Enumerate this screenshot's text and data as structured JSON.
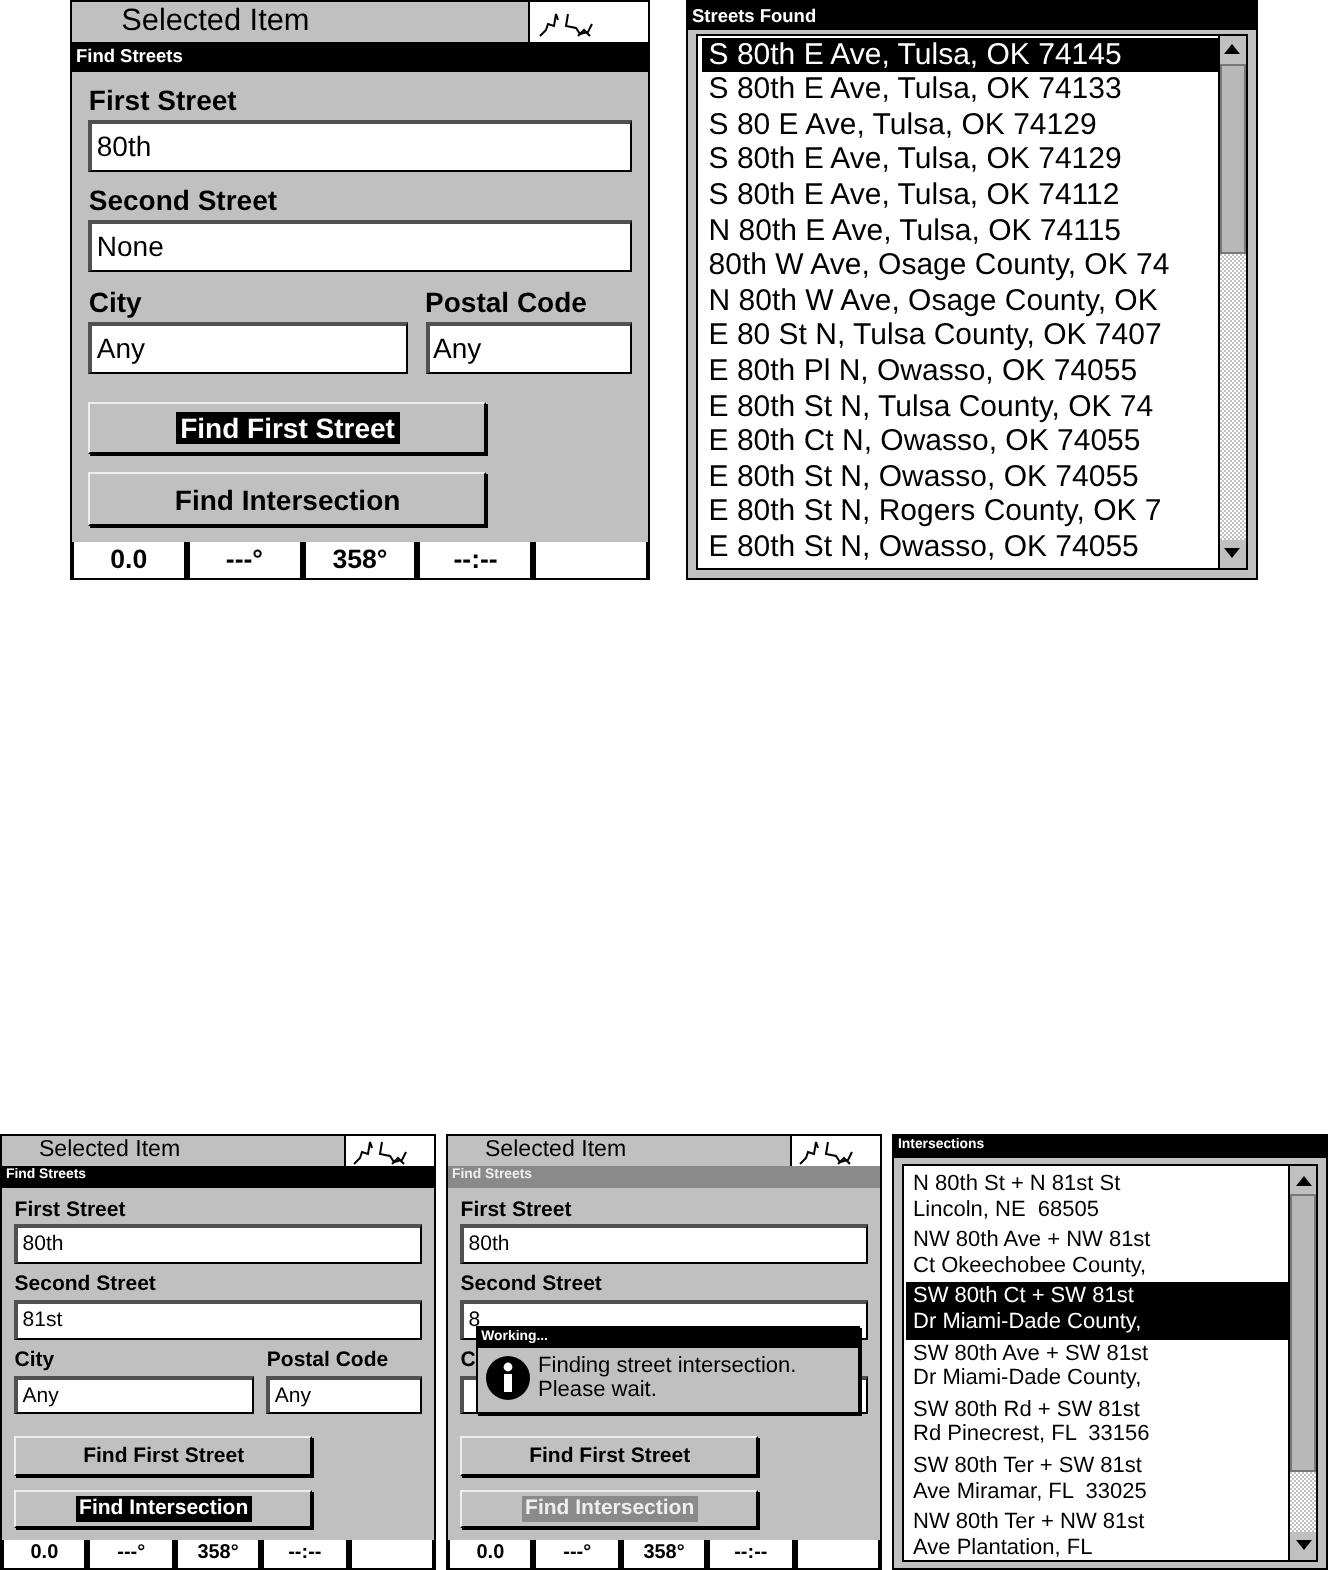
{
  "screens": [
    {
      "kind": "form",
      "header": {
        "title": "Selected Item"
      },
      "title_bar": {
        "text": "Find Streets",
        "active": true
      },
      "fields": [
        {
          "label": "First Street",
          "value": "80th"
        },
        {
          "label": "Second Street",
          "value": "None"
        },
        {
          "label": "City",
          "value": "Any"
        },
        {
          "label": "Postal Code",
          "value": "Any"
        }
      ],
      "buttons": [
        {
          "label": "Find First Street",
          "selected": true
        },
        {
          "label": "Find Intersection",
          "selected": false
        }
      ],
      "status_bar": [
        "0.0",
        "---°",
        "358°",
        "--:--"
      ]
    },
    {
      "kind": "list",
      "title_bar": {
        "text": "Streets Found",
        "active": true
      },
      "items": [
        {
          "lines": [
            "S 80th E Ave, Tulsa, OK 74145"
          ],
          "selected": true
        },
        {
          "lines": [
            "S 80th E Ave, Tulsa, OK 74133"
          ],
          "selected": false
        },
        {
          "lines": [
            "S 80 E Ave, Tulsa, OK 74129"
          ],
          "selected": false
        },
        {
          "lines": [
            "S 80th E Ave, Tulsa, OK 74129"
          ],
          "selected": false
        },
        {
          "lines": [
            "S 80th E Ave, Tulsa, OK 74112"
          ],
          "selected": false
        },
        {
          "lines": [
            "N 80th E Ave, Tulsa, OK 74115"
          ],
          "selected": false
        },
        {
          "lines": [
            "80th W Ave, Osage County, OK 74"
          ],
          "selected": false
        },
        {
          "lines": [
            "N 80th W Ave, Osage County, OK"
          ],
          "selected": false
        },
        {
          "lines": [
            "E 80 St N, Tulsa County, OK 7407"
          ],
          "selected": false
        },
        {
          "lines": [
            "E 80th Pl N, Owasso, OK 74055"
          ],
          "selected": false
        },
        {
          "lines": [
            "E 80th St N, Tulsa County, OK 74"
          ],
          "selected": false
        },
        {
          "lines": [
            "E 80th Ct N, Owasso, OK 74055"
          ],
          "selected": false
        },
        {
          "lines": [
            "E 80th St N, Owasso, OK 74055"
          ],
          "selected": false
        },
        {
          "lines": [
            "E 80th St N, Rogers County, OK 7"
          ],
          "selected": false
        },
        {
          "lines": [
            "E 80th St N, Owasso, OK 74055"
          ],
          "selected": false
        }
      ]
    },
    {
      "kind": "form",
      "header": {
        "title": "Selected Item"
      },
      "title_bar": {
        "text": "Find Streets",
        "active": true
      },
      "fields": [
        {
          "label": "First Street",
          "value": "80th"
        },
        {
          "label": "Second Street",
          "value": "81st"
        },
        {
          "label": "City",
          "value": "Any"
        },
        {
          "label": "Postal Code",
          "value": "Any"
        }
      ],
      "buttons": [
        {
          "label": "Find First Street",
          "selected": false
        },
        {
          "label": "Find Intersection",
          "selected": true
        }
      ],
      "status_bar": [
        "0.0",
        "---°",
        "358°",
        "--:--"
      ]
    },
    {
      "kind": "form",
      "header": {
        "title": "Selected Item"
      },
      "title_bar": {
        "text": "Find Streets",
        "active": false
      },
      "fields": [
        {
          "label": "First Street",
          "value": "80th"
        },
        {
          "label": "Second Street",
          "value": "8"
        },
        {
          "label": "C"
        }
      ],
      "buttons": [
        {
          "label": "Find First Street",
          "selected": false
        },
        {
          "label": "Find Intersection",
          "selected": true
        }
      ],
      "dialog": {
        "title": "Working...",
        "lines": [
          "Finding street intersection.",
          "Please wait."
        ]
      },
      "status_bar": [
        "0.0",
        "---°",
        "358°",
        "--:--"
      ]
    },
    {
      "kind": "list",
      "title_bar": {
        "text": "Intersections",
        "active": true
      },
      "items": [
        {
          "lines": [
            "N 80th St + N 81st St",
            "Lincoln, NE  68505"
          ],
          "selected": false
        },
        {
          "lines": [
            "NW 80th Ave + NW 81st",
            "Ct Okeechobee County,"
          ],
          "selected": false
        },
        {
          "lines": [
            "SW 80th Ct + SW 81st",
            "Dr Miami-Dade County,"
          ],
          "selected": true
        },
        {
          "lines": [
            "SW 80th Ave + SW 81st",
            "Dr Miami-Dade County,"
          ],
          "selected": false
        },
        {
          "lines": [
            "SW 80th Rd + SW 81st",
            "Rd Pinecrest, FL  33156"
          ],
          "selected": false
        },
        {
          "lines": [
            "SW 80th Ter + SW 81st",
            "Ave Miramar, FL  33025"
          ],
          "selected": false
        },
        {
          "lines": [
            "NW 80th Ter + NW 81st",
            "Ave Plantation, FL"
          ],
          "selected": false
        }
      ]
    }
  ]
}
